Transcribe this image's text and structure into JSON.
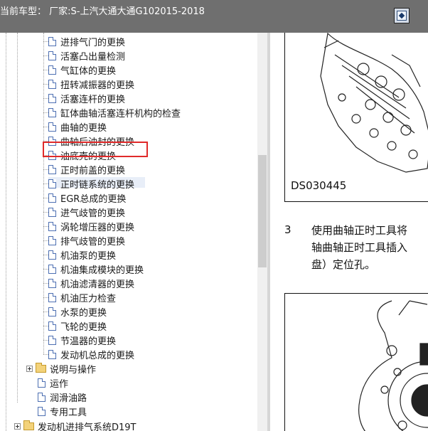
{
  "header": {
    "title": "当前车型： 厂家:S-上汽大通大通G102015-2018",
    "button_icon": "dock-toggle-icon"
  },
  "tree": {
    "items": [
      {
        "label": "进排气门的更换"
      },
      {
        "label": "活塞凸出量检测"
      },
      {
        "label": "气缸体的更换"
      },
      {
        "label": "扭转减振器的更换"
      },
      {
        "label": "活塞连杆的更换"
      },
      {
        "label": "缸体曲轴活塞连杆机构的检查"
      },
      {
        "label": "曲轴的更换"
      },
      {
        "label": "曲轴后油封的更换"
      },
      {
        "label": "油底壳的更换"
      },
      {
        "label": "正时前盖的更换"
      },
      {
        "label": "正时链系统的更换",
        "selected": true
      },
      {
        "label": "EGR总成的更换"
      },
      {
        "label": "进气歧管的更换"
      },
      {
        "label": "涡轮增压器的更换"
      },
      {
        "label": "排气歧管的更换"
      },
      {
        "label": "机油泵的更换"
      },
      {
        "label": "机油集成模块的更换"
      },
      {
        "label": "机油滤清器的更换"
      },
      {
        "label": "机油压力检查"
      },
      {
        "label": "水泵的更换"
      },
      {
        "label": "飞轮的更换"
      },
      {
        "label": "节温器的更换"
      },
      {
        "label": "发动机总成的更换"
      }
    ],
    "folder_item": {
      "label": "说明与操作"
    },
    "doc_items": [
      {
        "label": "运作"
      },
      {
        "label": "润滑油路"
      },
      {
        "label": "专用工具"
      }
    ],
    "bottom_folder": {
      "label": "发动机进排气系统D19T"
    }
  },
  "content": {
    "figure1_caption": "DS030445",
    "step_number": "3",
    "step_text": "使用曲轴正时工具将\n轴曲轴正时工具插入\n盘）定位孔。"
  }
}
